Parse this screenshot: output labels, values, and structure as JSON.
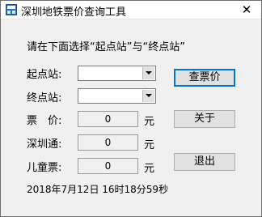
{
  "window": {
    "title": "深圳地铁票价查询工具",
    "close_symbol": "✕"
  },
  "instruction": "请在下面选择“起点站”与“终点站”",
  "form": {
    "start_label": "起点站:",
    "start_value": "",
    "end_label": "终点站:",
    "end_value": "",
    "fare_label": "票　价:",
    "fare_value": "0",
    "fare_unit": "元",
    "sztong_label": "深圳通:",
    "sztong_value": "0",
    "sztong_unit": "元",
    "child_label": "儿童票:",
    "child_value": "0",
    "child_unit": "元"
  },
  "buttons": {
    "query": "查票价",
    "about": "关于",
    "exit": "退出"
  },
  "status": {
    "datetime": "2018年7月12日  16时18分59秒"
  },
  "icons": {
    "app": "app-icon",
    "close": "close-icon",
    "dropdown": "chevron-down-icon"
  }
}
